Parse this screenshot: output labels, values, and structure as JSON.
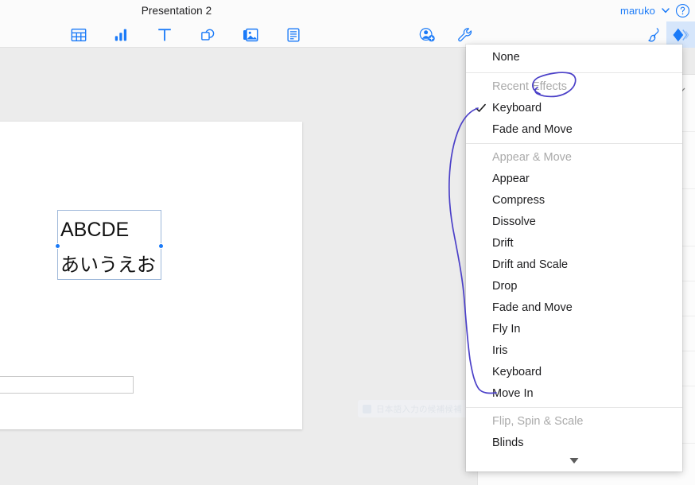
{
  "app": {
    "title": "Presentation 2",
    "account_name": "maruko",
    "chevron_icon": "chevron-down-icon",
    "help_icon": "question-mark-circle-icon",
    "accent_color": "#1a7af8",
    "active_tool_bg": "#d6e6fb"
  },
  "toolbar": {
    "left_tools": [
      {
        "name": "table-tool",
        "icon": "table-icon",
        "label": "Table"
      },
      {
        "name": "chart-tool",
        "icon": "bar-chart-icon",
        "label": "Chart"
      },
      {
        "name": "text-tool",
        "icon": "text-t-icon",
        "label": "Text"
      },
      {
        "name": "shape-tool",
        "icon": "shape-icon",
        "label": "Shape"
      },
      {
        "name": "media-tool",
        "icon": "media-image-icon",
        "label": "Media"
      },
      {
        "name": "comment-tool",
        "icon": "comment-lines-icon",
        "label": "Comment"
      }
    ],
    "mid_tools": [
      {
        "name": "collaborate-tool",
        "icon": "person-add-icon",
        "label": "Collaborate"
      },
      {
        "name": "tools-tool",
        "icon": "wrench-icon",
        "label": "Tools"
      }
    ],
    "right_tools": [
      {
        "name": "format-tool",
        "icon": "paintbrush-icon",
        "label": "Format",
        "active": false
      },
      {
        "name": "animate-tool",
        "icon": "animate-diamond-icon",
        "label": "Animate",
        "active": true
      }
    ]
  },
  "canvas": {
    "textbox": {
      "line1": "ABCDE",
      "line2": "あいうえお",
      "selected": true,
      "handle_color": "#1a7af8",
      "border_color": "#9db7d9"
    },
    "ghost_toast_text": "日本語入力の候補候補"
  },
  "menu": {
    "name": "build-effects-menu",
    "sections": [
      {
        "heading": null,
        "items": [
          {
            "label": "None",
            "checked": false,
            "muted": false
          }
        ]
      },
      {
        "heading": "Recent Effects",
        "items": [
          {
            "label": "Keyboard",
            "checked": true,
            "muted": false
          },
          {
            "label": "Fade and Move",
            "checked": false,
            "muted": false
          }
        ]
      },
      {
        "heading": "Appear & Move",
        "items": [
          {
            "label": "Appear",
            "checked": false,
            "muted": false
          },
          {
            "label": "Compress",
            "checked": false,
            "muted": false
          },
          {
            "label": "Dissolve",
            "checked": false,
            "muted": false
          },
          {
            "label": "Drift",
            "checked": false,
            "muted": false
          },
          {
            "label": "Drift and Scale",
            "checked": false,
            "muted": false
          },
          {
            "label": "Drop",
            "checked": false,
            "muted": false
          },
          {
            "label": "Fade and Move",
            "checked": false,
            "muted": false
          },
          {
            "label": "Fly In",
            "checked": false,
            "muted": false
          },
          {
            "label": "Iris",
            "checked": false,
            "muted": false
          },
          {
            "label": "Keyboard",
            "checked": false,
            "muted": false
          },
          {
            "label": "Move In",
            "checked": false,
            "muted": false
          }
        ]
      },
      {
        "heading": "Flip, Spin & Scale",
        "items": [
          {
            "label": "Blinds",
            "checked": false,
            "muted": false
          }
        ]
      }
    ],
    "scroll_down_icon": "caret-down-icon",
    "selected_effect": "Keyboard"
  },
  "annotations": {
    "ink_color": "#4b40c8",
    "marks": [
      {
        "name": "circle-around-effects",
        "target": "Effects"
      },
      {
        "name": "curve-keyboard-to-move-in",
        "from": "Keyboard",
        "to": "Move In"
      }
    ]
  }
}
